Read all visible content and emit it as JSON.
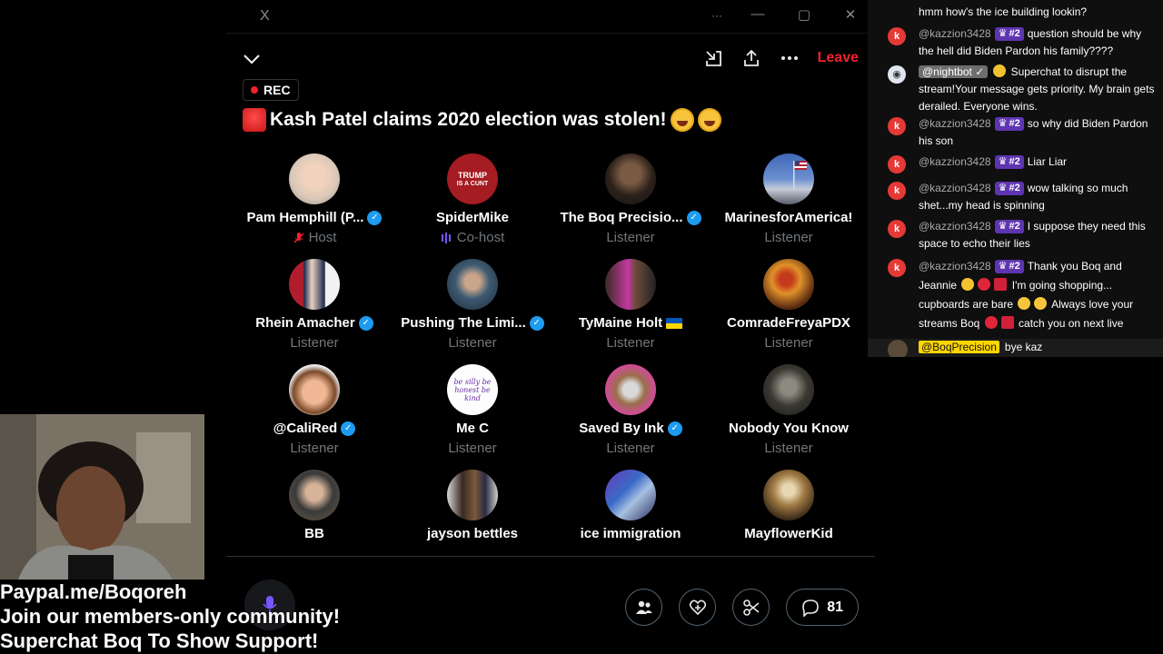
{
  "window": {
    "title": "X",
    "minimize": "—",
    "maximize": "▢",
    "close": "✕",
    "more": "···"
  },
  "space": {
    "leave_label": "Leave",
    "rec_label": "REC",
    "title": "Kash Patel claims 2020 election was stolen!",
    "comment_count": "81",
    "participants": [
      {
        "name": "Pam Hemphill (P...",
        "role": "Host",
        "verified": true,
        "role_icon": "mic-off-icon"
      },
      {
        "name": "SpiderMike",
        "role": "Co-host",
        "verified": false,
        "role_icon": "speaking-bars-icon"
      },
      {
        "name": "The Boq Precisio...",
        "role": "Listener",
        "verified": true
      },
      {
        "name": "MarinesforAmerica!",
        "role": "Listener",
        "verified": false
      },
      {
        "name": "Rhein Amacher",
        "role": "Listener",
        "verified": true
      },
      {
        "name": "Pushing The Limi...",
        "role": "Listener",
        "verified": true
      },
      {
        "name": "TyMaine Holt",
        "role": "Listener",
        "verified": false,
        "flag": "ukraine-flag-icon"
      },
      {
        "name": "ComradeFreyaPDX",
        "role": "Listener",
        "verified": false
      },
      {
        "name": "@CaliRed",
        "role": "Listener",
        "verified": true
      },
      {
        "name": "Me C",
        "role": "Listener",
        "verified": false
      },
      {
        "name": "Saved By Ink",
        "role": "Listener",
        "verified": true
      },
      {
        "name": "Nobody You Know",
        "role": "Listener",
        "verified": false
      },
      {
        "name": "BB",
        "role": "",
        "verified": false
      },
      {
        "name": "jayson bettles",
        "role": "",
        "verified": false
      },
      {
        "name": "ice immigration",
        "role": "",
        "verified": false
      },
      {
        "name": "MayflowerKid",
        "role": "",
        "verified": false
      }
    ],
    "avatar_text": {
      "spidermike_1": "TRUMP",
      "spidermike_2": "IS A CUNT",
      "mec": "be silly be honest be kind"
    }
  },
  "overlay": {
    "line1": "Paypal.me/Boqoreh",
    "line2": "Join our members-only community!",
    "line3": "Superchat Boq To Show Support!"
  },
  "chat": {
    "messages": [
      {
        "user": "",
        "badge": "",
        "text": "hmm how's the ice building lookin?"
      },
      {
        "user": "@kazzion3428",
        "badge": "#2",
        "text": "question should be why the hell did Biden Pardon his family????"
      },
      {
        "user": "@nightbot ✓",
        "badge": "",
        "text": "Superchat to disrupt the stream!Your message gets priority. My brain gets derailed. Everyone wins."
      },
      {
        "user": "@kazzion3428",
        "badge": "#2",
        "text": "so why did Biden Pardon his son"
      },
      {
        "user": "@kazzion3428",
        "badge": "#2",
        "text": "Liar Liar"
      },
      {
        "user": "@kazzion3428",
        "badge": "#2",
        "text": "wow talking so much shet...my head is spinning"
      },
      {
        "user": "@kazzion3428",
        "badge": "#2",
        "text": "I suppose they need this space to echo their lies"
      },
      {
        "user": "@kazzion3428",
        "badge": "#2",
        "text_a": "Thank you Boq and Jeannie",
        "text_b": "I'm going shopping... cupboards are bare",
        "text_c": "Always love your streams Boq",
        "text_d": "catch you on next live"
      },
      {
        "user": "@BoqPrecision",
        "badge": "",
        "text": "bye kaz"
      }
    ],
    "avatar_letter": "k"
  },
  "colors": {
    "leave": "#f4212e",
    "verified": "#1d9bf0",
    "member_badge": "#5e35b1",
    "owner_tag": "#ffd600"
  }
}
